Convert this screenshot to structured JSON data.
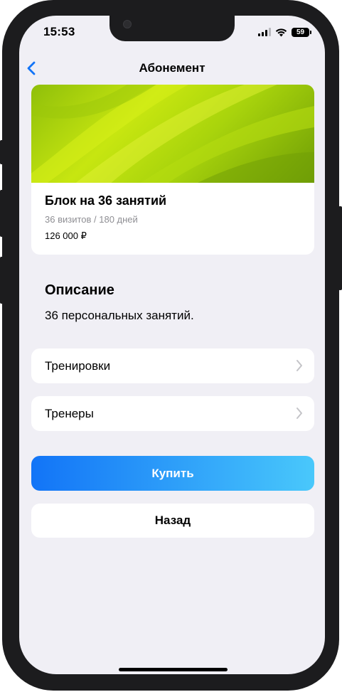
{
  "status_bar": {
    "time": "15:53",
    "battery": "59",
    "icons": [
      "cellular-signal-icon",
      "wifi-icon",
      "battery-icon"
    ]
  },
  "nav": {
    "title": "Абонемент",
    "back_icon": "chevron-left-icon"
  },
  "subscription": {
    "name": "Блок на 36 занятий",
    "visits": "36 визитов / 180 дней",
    "price": "126 000 ₽"
  },
  "description": {
    "heading": "Описание",
    "text": "36 персональных занятий."
  },
  "rows": [
    {
      "label": "Тренировки",
      "icon": "chevron-right-icon"
    },
    {
      "label": "Тренеры",
      "icon": "chevron-right-icon"
    }
  ],
  "actions": {
    "buy_label": "Купить",
    "back_label": "Назад"
  },
  "colors": {
    "accent": "#1274f7",
    "accent_end": "#49c8fb",
    "background": "#f0eff5",
    "card": "#ffffff",
    "secondary_text": "#8e8e93",
    "image_green": "#c7e610"
  }
}
